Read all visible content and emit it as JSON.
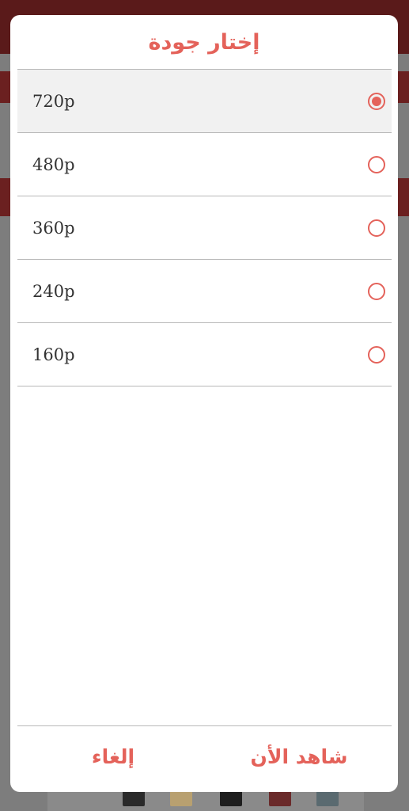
{
  "dialog": {
    "title": "إختار جودة",
    "options": [
      {
        "label": "720p",
        "selected": true
      },
      {
        "label": "480p",
        "selected": false
      },
      {
        "label": "360p",
        "selected": false
      },
      {
        "label": "240p",
        "selected": false
      },
      {
        "label": "160p",
        "selected": false
      }
    ],
    "cancel_label": "إلغاء",
    "watch_label": "شاهد الأن"
  },
  "colors": {
    "accent": "#e4625a",
    "selected_bg": "#f1f1f1",
    "divider": "#b8b8b8"
  },
  "icons": {
    "radio_selected": "radio-selected-icon",
    "radio_unselected": "radio-unselected-icon"
  }
}
